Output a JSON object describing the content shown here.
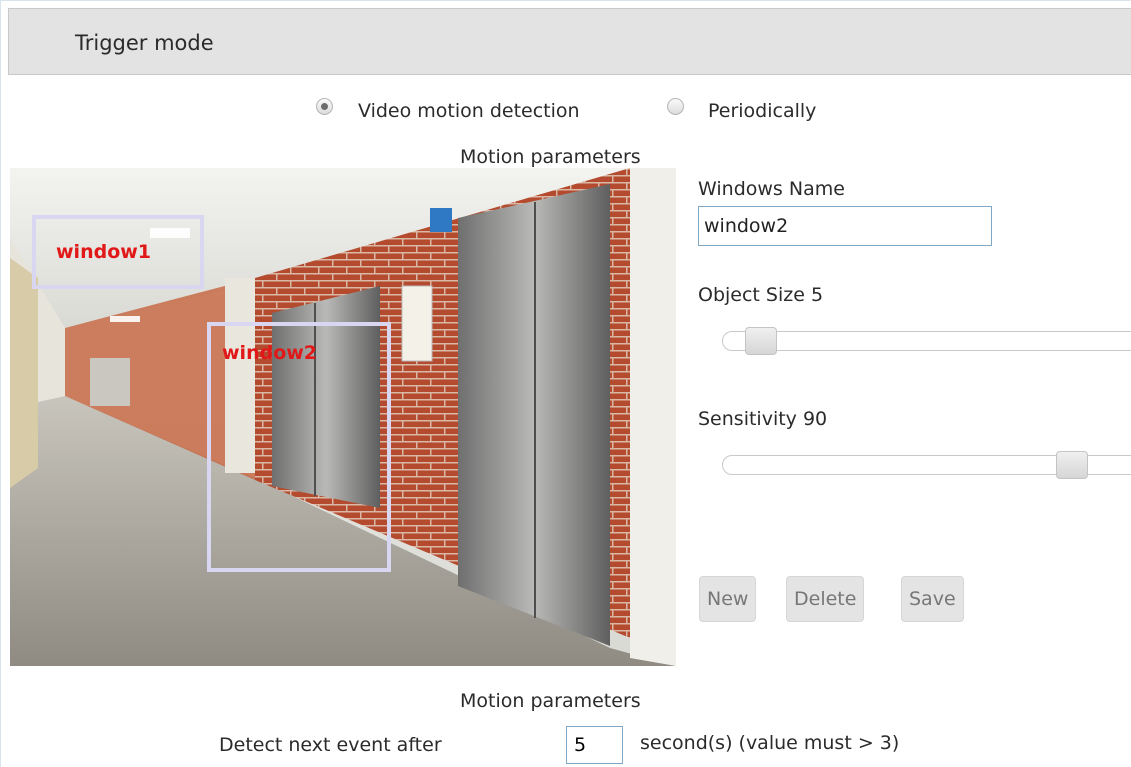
{
  "header": {
    "title": "Trigger mode"
  },
  "trigger_mode": {
    "options": [
      {
        "label": "Video motion detection",
        "selected": true
      },
      {
        "label": "Periodically",
        "selected": false
      }
    ]
  },
  "motion_section": {
    "title": "Motion parameters"
  },
  "video": {
    "windows": [
      {
        "label": "window1",
        "selected": false
      },
      {
        "label": "window2",
        "selected": true
      }
    ]
  },
  "window_settings": {
    "name_label": "Windows Name",
    "name_value": "window2",
    "object_size": {
      "label": "Object Size 5",
      "value": 5,
      "max": 100
    },
    "sensitivity": {
      "label": "Sensitivity 90",
      "value": 90,
      "max": 100
    }
  },
  "actions": {
    "new_label": "New",
    "delete_label": "Delete",
    "save_label": "Save"
  },
  "event_section": {
    "title": "Motion parameters",
    "detect_label": "Detect next event after",
    "detect_value": "5",
    "detect_suffix": "second(s) (value must > 3)"
  },
  "colors": {
    "window_label": "#e01818",
    "window_border": "#d9d6f2",
    "header_bg": "#e3e3e3"
  }
}
